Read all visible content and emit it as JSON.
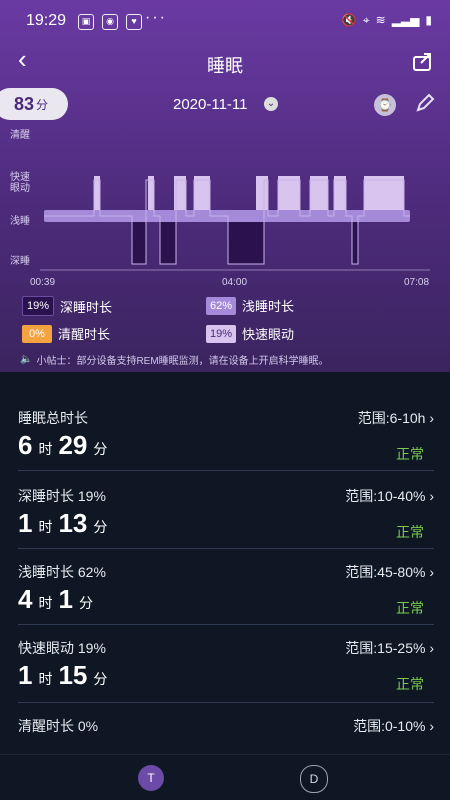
{
  "status_bar": {
    "time": "19:29",
    "dots": "···"
  },
  "app_bar": {
    "title": "睡眠"
  },
  "score": {
    "value": "83",
    "unit": "分"
  },
  "date": "2020-11-11",
  "chart": {
    "y_labels": [
      "清醒",
      "快速\n眼动",
      "浅睡",
      "深睡"
    ],
    "x_labels": [
      "00:39",
      "04:00",
      "07:08"
    ]
  },
  "legend": [
    {
      "percent": "19%",
      "label": "深睡时长",
      "color": "#2b124f",
      "text_color": "#ffffff"
    },
    {
      "percent": "62%",
      "label": "浅睡时长",
      "color": "#a48ad9",
      "text_color": "#ffffff"
    },
    {
      "percent": "0%",
      "label": "清醒时长",
      "color": "#f4a340",
      "text_color": "#ffffff"
    },
    {
      "percent": "19%",
      "label": "快速眼动",
      "color": "#d9c4ef",
      "text_color": "#4b2a78"
    }
  ],
  "tip": "小帖士：部分设备支持REM睡眠监测，请在设备上开启科学睡眠。",
  "items": [
    {
      "label": "睡眠总时长",
      "range": "范围:6-10h",
      "h": "6",
      "hu": "时",
      "m": "29",
      "mu": "分",
      "status": "正常"
    },
    {
      "label": "深睡时长 19%",
      "range": "范围:10-40%",
      "h": "1",
      "hu": "时",
      "m": "13",
      "mu": "分",
      "status": "正常"
    },
    {
      "label": "浅睡时长 62%",
      "range": "范围:45-80%",
      "h": "4",
      "hu": "时",
      "m": "1",
      "mu": "分",
      "status": "正常"
    },
    {
      "label": "快速眼动 19%",
      "range": "范围:15-25%",
      "h": "1",
      "hu": "时",
      "m": "15",
      "mu": "分",
      "status": "正常"
    },
    {
      "label": "清醒时长 0%",
      "range": "范围:0-10%",
      "h": "",
      "hu": "",
      "m": "",
      "mu": "",
      "status": ""
    }
  ],
  "bottom_nav": {
    "left": "T",
    "right": "D"
  }
}
